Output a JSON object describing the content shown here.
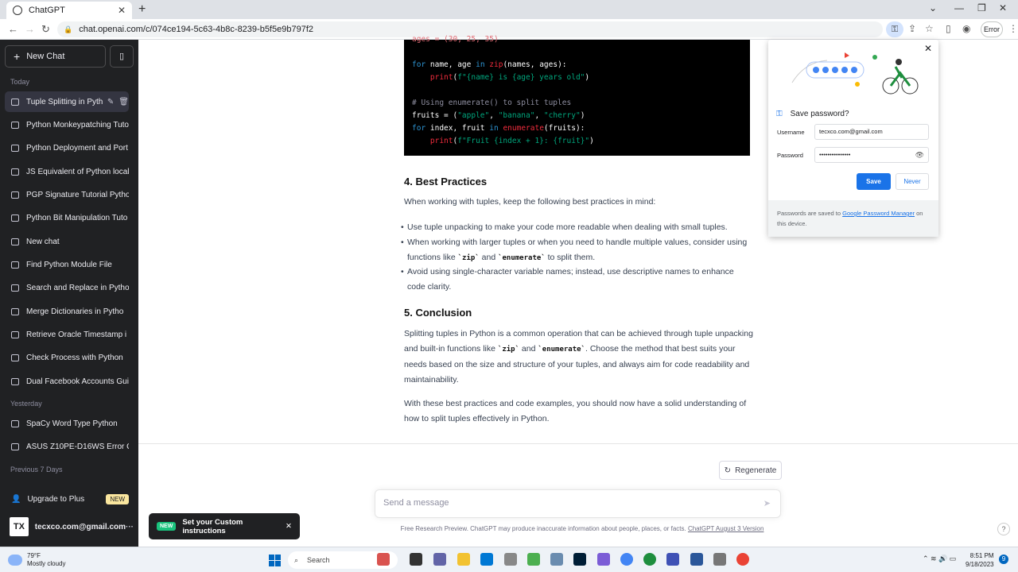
{
  "browser": {
    "tab_title": "ChatGPT",
    "url": "chat.openai.com/c/074ce194-5c63-4b8c-8239-b5f5e9b797f2",
    "error_label": "Error"
  },
  "sidebar": {
    "new_chat": "New Chat",
    "today": "Today",
    "yesterday": "Yesterday",
    "prev7": "Previous 7 Days",
    "items": [
      "Tuple Splitting in Pyth",
      "Python Monkeypatching Tuto",
      "Python Deployment and Port",
      "JS Equivalent of Python local",
      "PGP Signature Tutorial Pytho",
      "Python Bit Manipulation Tuto",
      "New chat",
      "Find Python Module File",
      "Search and Replace in Pytho",
      "Merge Dictionaries in Pytho",
      "Retrieve Oracle Timestamp i",
      "Check Process with Python",
      "Dual Facebook Accounts Gui"
    ],
    "yesterday_items": [
      "SpaCy Word Type Python",
      "ASUS Z10PE-D16WS Error Co"
    ],
    "upgrade": "Upgrade to Plus",
    "new_badge": "NEW",
    "avatar": "TX",
    "user_email": "tecxco.com@gmail.com"
  },
  "code": {
    "line0": "ages = (30, 25, 35)",
    "line1_kw": "for",
    "line1_a": " name, age ",
    "line1_in": "in",
    "line1_fn": "zip",
    "line1_b": "(names, ages):",
    "line2_fn": "print",
    "line2_str": "f\"{name} is {age} years old\"",
    "line3": "# Using enumerate() to split tuples",
    "line4_a": "fruits = (",
    "line4_s1": "\"apple\"",
    "line4_s2": "\"banana\"",
    "line4_s3": "\"cherry\"",
    "line4_b": ")",
    "line5_kw": "for",
    "line5_a": " index, fruit ",
    "line5_in": "in",
    "line5_fn": "enumerate",
    "line5_b": "(fruits):",
    "line6_fn": "print",
    "line6_str": "f\"Fruit {index + 1}: {fruit}\""
  },
  "article": {
    "h4": "4. Best Practices",
    "p4": "When working with tuples, keep the following best practices in mind:",
    "b1": "Use tuple unpacking to make your code more readable when dealing with small tuples.",
    "b2_a": "When working with larger tuples or when you need to handle multiple values, consider using functions like",
    "b2_zip": "`zip`",
    "b2_and": "and",
    "b2_enum": "`enumerate`",
    "b2_end": "to split them.",
    "b3": "Avoid using single-character variable names; instead, use descriptive names to enhance code clarity.",
    "h5": "5. Conclusion",
    "p5_a": "Splitting tuples in Python is a common operation that can be achieved through tuple unpacking and built-in functions like",
    "p5_zip": "`zip`",
    "p5_and": "and",
    "p5_enum": "`enumerate`",
    "p5_b": ". Choose the method that best suits your needs based on the size and structure of your tuples, and always aim for code readability and maintainability.",
    "p6": "With these best practices and code examples, you should now have a solid understanding of how to split tuples effectively in Python."
  },
  "composer": {
    "regenerate": "Regenerate",
    "placeholder": "Send a message",
    "footnote": "Free Research Preview. ChatGPT may produce inaccurate information about people, places, or facts.",
    "footnote_link": "ChatGPT August 3 Version"
  },
  "toast": {
    "badge": "NEW",
    "text": "Set your Custom instructions"
  },
  "password_popup": {
    "title": "Save password?",
    "username_label": "Username",
    "username": "tecxco.com@gmail.com",
    "password_label": "Password",
    "password": "•••••••••••••••",
    "save": "Save",
    "never": "Never",
    "foot_a": "Passwords are saved to",
    "foot_link": "Google Password Manager",
    "foot_b": "on this device."
  },
  "taskbar": {
    "temp": "79°F",
    "weather": "Mostly cloudy",
    "search": "Search",
    "time": "8:51 PM",
    "date": "9/18/2023",
    "notif": "9"
  }
}
